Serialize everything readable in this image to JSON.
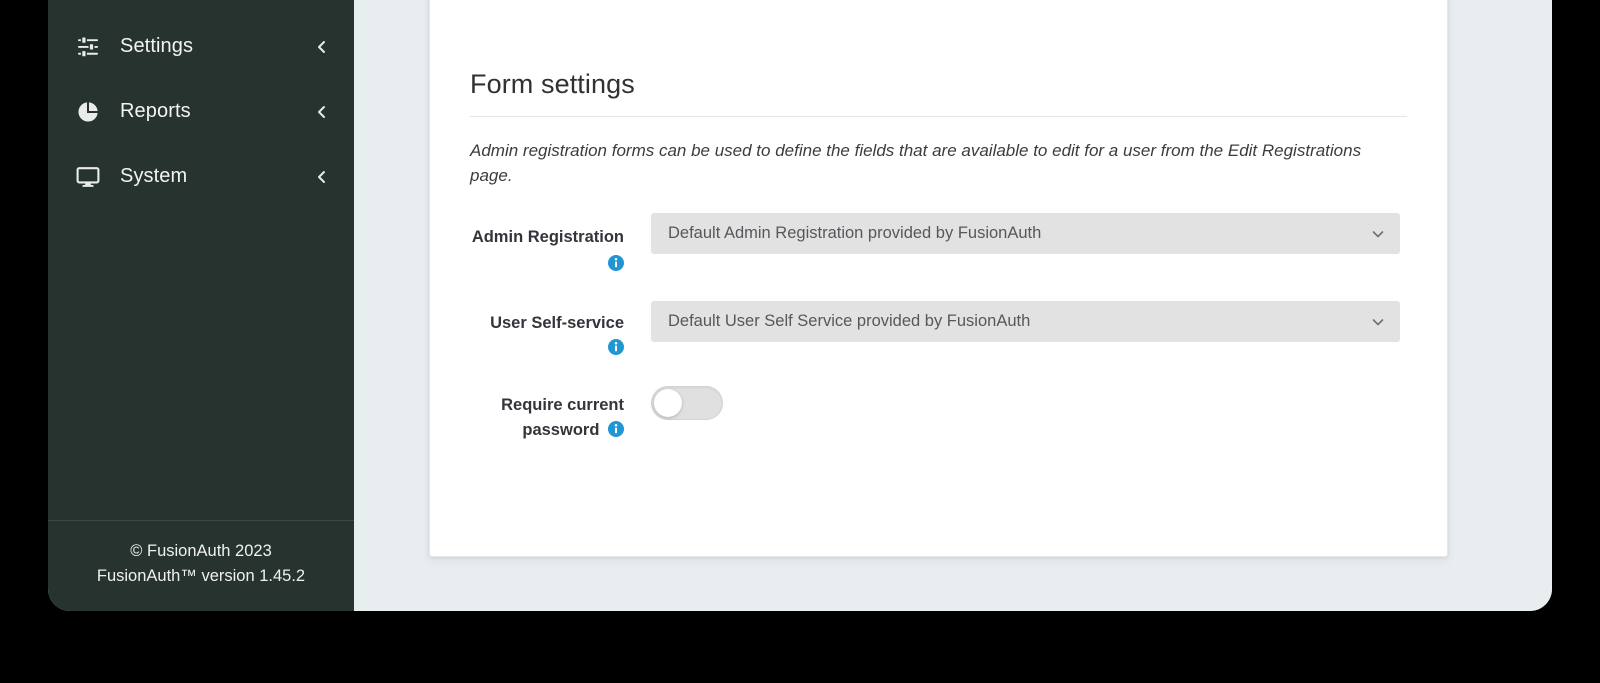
{
  "sidebar": {
    "items": [
      {
        "label": "Settings",
        "icon": "sliders-icon",
        "chevron": "chevron-left-icon"
      },
      {
        "label": "Reports",
        "icon": "pie-chart-icon",
        "chevron": "chevron-left-icon"
      },
      {
        "label": "System",
        "icon": "monitor-icon",
        "chevron": "chevron-left-icon"
      }
    ],
    "footer": {
      "copyright": "© FusionAuth 2023",
      "version": "FusionAuth™ version 1.45.2"
    },
    "background_color": "#26332f"
  },
  "main": {
    "page_title": "Form settings",
    "description": "Admin registration forms can be used to define the fields that are available to edit for a user from the Edit Registrations page.",
    "fields": [
      {
        "label": "Admin Registration",
        "icon": "info-icon",
        "icon_position": "below",
        "control": "select",
        "value": "Default Admin Registration provided by FusionAuth",
        "chevron": "chevron-down-icon"
      },
      {
        "label": "User Self-service",
        "icon": "info-icon",
        "icon_position": "inline",
        "control": "select",
        "value": "Default User Self Service provided by FusionAuth",
        "chevron": "chevron-down-icon"
      },
      {
        "label": "Require current password",
        "icon": "info-icon",
        "icon_position": "inline",
        "control": "toggle",
        "value": "off"
      }
    ]
  },
  "colors": {
    "sidebar_bg": "#26332f",
    "page_bg": "#e8edf0",
    "card_bg": "#ffffff",
    "select_bg": "#e2e2e2",
    "info_blue": "#2196d3",
    "toggle_off": "#e0e0e0",
    "outside_bg": "#000000"
  }
}
